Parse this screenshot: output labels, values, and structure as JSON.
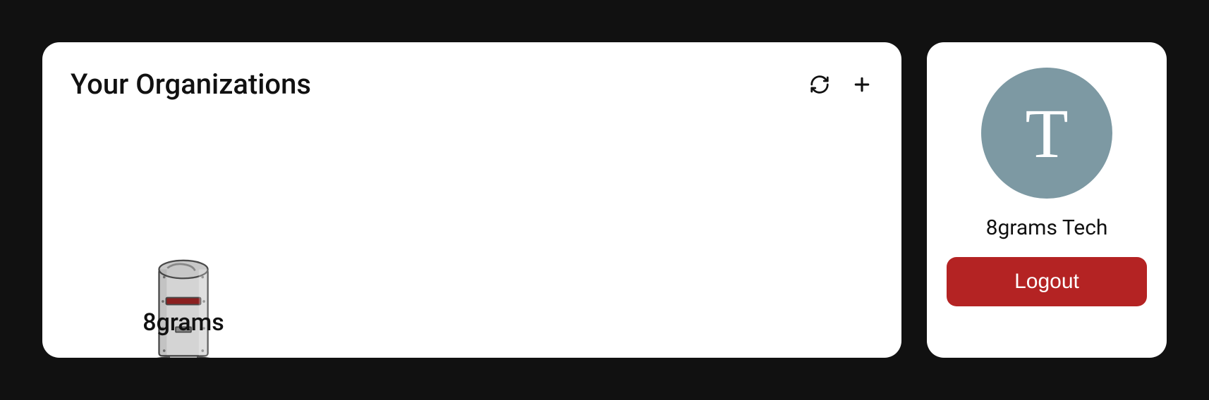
{
  "organizations": {
    "title": "Your Organizations",
    "items": [
      {
        "name": "8grams"
      }
    ]
  },
  "user": {
    "avatar_letter": "T",
    "name": "8grams Tech",
    "logout_label": "Logout"
  }
}
